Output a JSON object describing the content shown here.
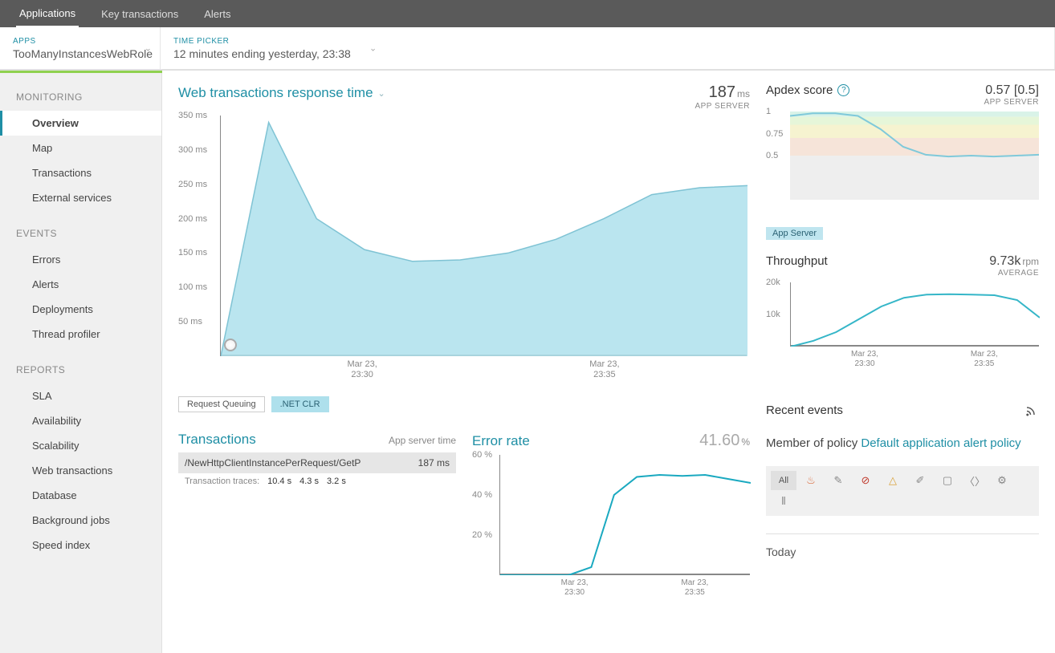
{
  "topnav": {
    "tabs": [
      {
        "label": "Applications",
        "active": true
      },
      {
        "label": "Key transactions",
        "active": false
      },
      {
        "label": "Alerts",
        "active": false
      }
    ]
  },
  "selectors": {
    "apps": {
      "label": "APPS",
      "value": "TooManyInstancesWebRole"
    },
    "time": {
      "label": "TIME PICKER",
      "value": "12 minutes ending yesterday, 23:38"
    }
  },
  "sidebar": {
    "sections": [
      {
        "title": "MONITORING",
        "items": [
          {
            "label": "Overview",
            "active": true
          },
          {
            "label": "Map"
          },
          {
            "label": "Transactions"
          },
          {
            "label": "External services"
          }
        ]
      },
      {
        "title": "EVENTS",
        "items": [
          {
            "label": "Errors"
          },
          {
            "label": "Alerts"
          },
          {
            "label": "Deployments"
          },
          {
            "label": "Thread profiler"
          }
        ]
      },
      {
        "title": "REPORTS",
        "items": [
          {
            "label": "SLA"
          },
          {
            "label": "Availability"
          },
          {
            "label": "Scalability"
          },
          {
            "label": "Web transactions"
          },
          {
            "label": "Database"
          },
          {
            "label": "Background jobs"
          },
          {
            "label": "Speed index"
          }
        ]
      }
    ]
  },
  "response_time_card": {
    "title": "Web transactions response time",
    "metric_value": "187",
    "metric_unit": "ms",
    "metric_sub": "APP SERVER",
    "legend": [
      {
        "label": "Request Queuing",
        "active": false
      },
      {
        "label": ".NET CLR",
        "active": true
      }
    ]
  },
  "apdex_card": {
    "title": "Apdex score",
    "metric_value": "0.57 [0.5]",
    "metric_sub": "APP SERVER",
    "pill": "App Server"
  },
  "throughput_card": {
    "title": "Throughput",
    "metric_value": "9.73k",
    "metric_unit": "rpm",
    "metric_sub": "AVERAGE"
  },
  "transactions_card": {
    "title": "Transactions",
    "sub": "App server time",
    "row": {
      "path": "/NewHttpClientInstancePerRequest/GetP",
      "time": "187 ms"
    },
    "traces_label": "Transaction traces:",
    "traces": [
      "10.4 s",
      "4.3 s",
      "3.2 s"
    ]
  },
  "error_rate_card": {
    "title": "Error rate",
    "metric_value": "41.60",
    "metric_unit": "%"
  },
  "recent_events": {
    "title": "Recent events",
    "policy_prefix": "Member of policy ",
    "policy_link": "Default application alert policy",
    "filter_all": "All",
    "today": "Today"
  },
  "chart_data": [
    {
      "id": "response_time",
      "type": "area",
      "title": "Web transactions response time",
      "ylabel": "ms",
      "ylim": [
        0,
        350
      ],
      "yticks": [
        50,
        100,
        150,
        200,
        250,
        300,
        350
      ],
      "xticks": [
        "Mar 23, 23:30",
        "Mar 23, 23:35"
      ],
      "x": [
        "23:27",
        "23:28",
        "23:29",
        "23:30",
        "23:31",
        "23:32",
        "23:33",
        "23:34",
        "23:35",
        "23:36",
        "23:37",
        "23:38"
      ],
      "series": [
        {
          "name": ".NET CLR",
          "values": [
            0,
            340,
            200,
            155,
            138,
            140,
            150,
            170,
            200,
            235,
            245,
            248
          ],
          "color": "#aee0ec"
        }
      ]
    },
    {
      "id": "apdex",
      "type": "line",
      "title": "Apdex score",
      "ylim": [
        0,
        1
      ],
      "yticks": [
        0.5,
        0.75,
        1
      ],
      "bands": [
        {
          "from": 0.94,
          "to": 1.0,
          "color": "#d9f3e8"
        },
        {
          "from": 0.85,
          "to": 0.94,
          "color": "#e6f6d9"
        },
        {
          "from": 0.7,
          "to": 0.85,
          "color": "#f6f3d0"
        },
        {
          "from": 0.5,
          "to": 0.7,
          "color": "#f6e4d9"
        },
        {
          "from": 0.0,
          "to": 0.5,
          "color": "#eeeeee"
        }
      ],
      "x": [
        "23:27",
        "23:28",
        "23:29",
        "23:30",
        "23:31",
        "23:32",
        "23:33",
        "23:34",
        "23:35",
        "23:36",
        "23:37",
        "23:38"
      ],
      "series": [
        {
          "name": "App Server",
          "values": [
            0.95,
            0.98,
            0.98,
            0.95,
            0.8,
            0.6,
            0.51,
            0.49,
            0.5,
            0.49,
            0.5,
            0.51
          ],
          "color": "#7fc9da"
        }
      ]
    },
    {
      "id": "throughput",
      "type": "line",
      "title": "Throughput",
      "ylabel": "rpm",
      "ylim": [
        0,
        20000
      ],
      "yticks": [
        10000,
        20000
      ],
      "ytick_labels": [
        "10k",
        "20k"
      ],
      "xticks": [
        "Mar 23, 23:30",
        "Mar 23, 23:35"
      ],
      "x": [
        "23:27",
        "23:28",
        "23:29",
        "23:30",
        "23:31",
        "23:32",
        "23:33",
        "23:34",
        "23:35",
        "23:36",
        "23:37",
        "23:38"
      ],
      "series": [
        {
          "name": "Throughput",
          "values": [
            0,
            1800,
            4500,
            8500,
            12500,
            15200,
            16200,
            16300,
            16200,
            16000,
            14500,
            9000
          ],
          "color": "#35b6c8"
        }
      ]
    },
    {
      "id": "error_rate",
      "type": "line",
      "title": "Error rate",
      "ylabel": "%",
      "ylim": [
        0,
        60
      ],
      "yticks": [
        20,
        40,
        60
      ],
      "ytick_labels": [
        "20 %",
        "40 %",
        "60 %"
      ],
      "xticks": [
        "Mar 23, 23:30",
        "Mar 23, 23:35"
      ],
      "x": [
        "23:27",
        "23:28",
        "23:29",
        "23:30",
        "23:31",
        "23:32",
        "23:33",
        "23:34",
        "23:35",
        "23:36",
        "23:37",
        "23:38"
      ],
      "series": [
        {
          "name": "Error rate",
          "values": [
            0,
            0,
            0,
            0,
            4,
            40,
            49,
            50,
            49.5,
            50,
            48,
            46
          ],
          "color": "#1aa9c0"
        }
      ]
    }
  ]
}
